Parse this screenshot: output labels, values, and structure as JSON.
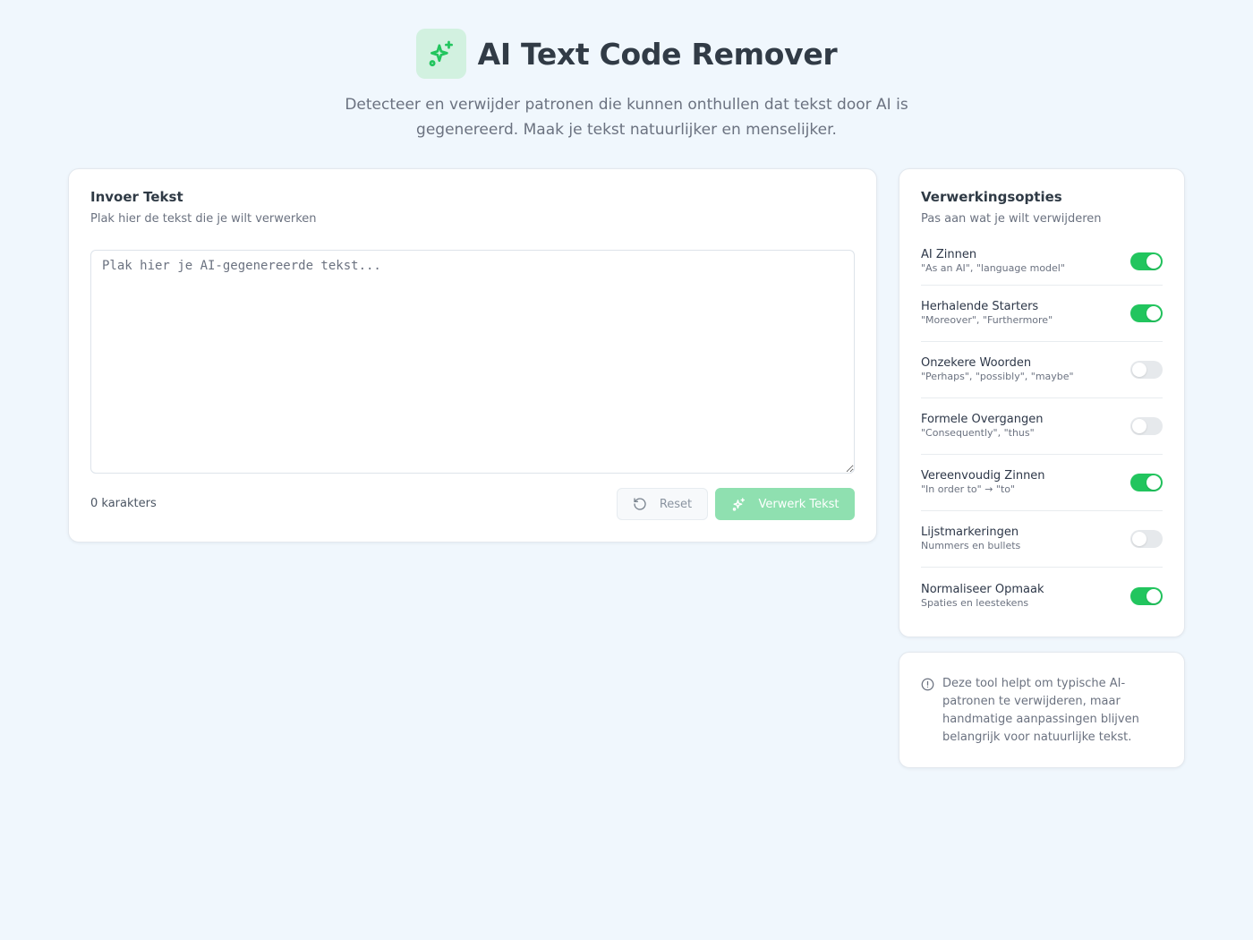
{
  "header": {
    "title": "AI Text Code Remover",
    "subtitle": "Detecteer en verwijder patronen die kunnen onthullen dat tekst door AI is gegenereerd. Maak je tekst natuurlijker en menselijker.",
    "logo_icon": "sparkles-icon",
    "accent_color": "#22c55e"
  },
  "input": {
    "title": "Invoer Tekst",
    "description": "Plak hier de tekst die je wilt verwerken",
    "placeholder": "Plak hier je AI-gegenereerde tekst...",
    "value": "",
    "char_count": "0 karakters",
    "reset_label": "Reset",
    "process_label": "Verwerk Tekst"
  },
  "options": {
    "title": "Verwerkingsopties",
    "description": "Pas aan wat je wilt verwijderen",
    "items": [
      {
        "label": "AI Zinnen",
        "desc": "\"As an AI\", \"language model\"",
        "enabled": true
      },
      {
        "label": "Herhalende Starters",
        "desc": "\"Moreover\", \"Furthermore\"",
        "enabled": true
      },
      {
        "label": "Onzekere Woorden",
        "desc": "\"Perhaps\", \"possibly\", \"maybe\"",
        "enabled": false
      },
      {
        "label": "Formele Overgangen",
        "desc": "\"Consequently\", \"thus\"",
        "enabled": false
      },
      {
        "label": "Vereenvoudig Zinnen",
        "desc": "\"In order to\" → \"to\"",
        "enabled": true
      },
      {
        "label": "Lijstmarkeringen",
        "desc": "Nummers en bullets",
        "enabled": false
      },
      {
        "label": "Normaliseer Opmaak",
        "desc": "Spaties en leestekens",
        "enabled": true
      }
    ]
  },
  "info": {
    "text": "Deze tool helpt om typische AI-patronen te verwijderen, maar handmatige aanpassingen blijven belangrijk voor natuurlijke tekst.",
    "icon": "info-circle-icon"
  }
}
